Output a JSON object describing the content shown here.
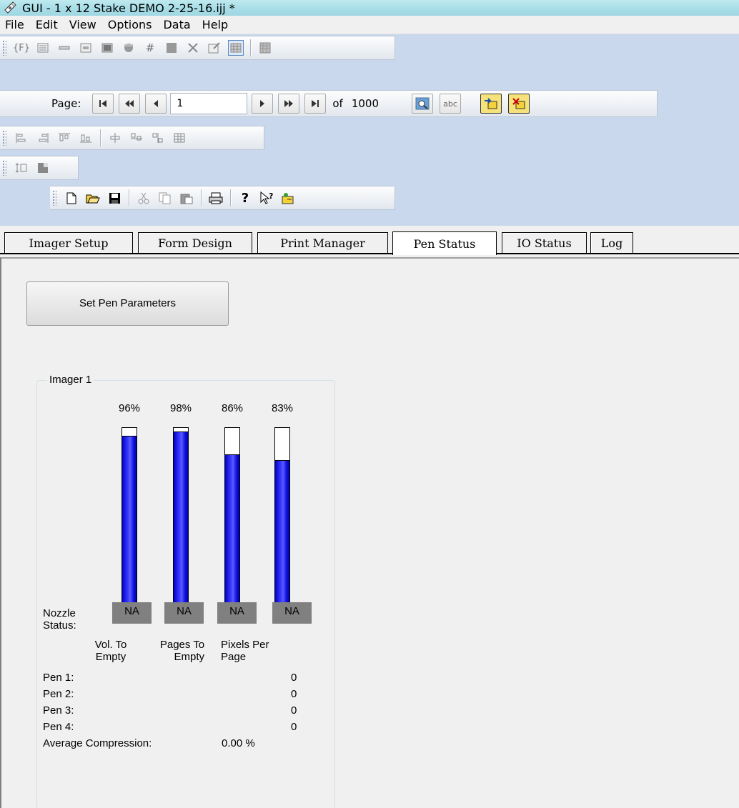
{
  "window": {
    "title": "GUI - 1 x 12 Stake DEMO 2-25-16.ijj *"
  },
  "menu": [
    "File",
    "Edit",
    "View",
    "Options",
    "Data",
    "Help"
  ],
  "page_nav": {
    "label": "Page:",
    "current": "1",
    "of_label": "of",
    "total": "1000",
    "abc_label": "abc"
  },
  "tabs": [
    {
      "label": "Imager Setup",
      "active": false
    },
    {
      "label": "Form Design",
      "active": false
    },
    {
      "label": "Print Manager",
      "active": false
    },
    {
      "label": "Pen Status",
      "active": true
    },
    {
      "label": "IO Status",
      "active": false
    },
    {
      "label": "Log",
      "active": false
    }
  ],
  "pen_status": {
    "set_params_label": "Set Pen Parameters",
    "group_label": "Imager 1",
    "pens": [
      {
        "number": "1",
        "level_label": "96%",
        "level": 0.96,
        "nozzle": "NA"
      },
      {
        "number": "2",
        "level_label": "98%",
        "level": 0.98,
        "nozzle": "NA"
      },
      {
        "number": "3",
        "level_label": "86%",
        "level": 0.86,
        "nozzle": "NA"
      },
      {
        "number": "4",
        "level_label": "83%",
        "level": 0.83,
        "nozzle": "NA"
      }
    ],
    "nozzle_label_1": "Nozzle",
    "nozzle_label_2": "Status:",
    "col_vol_1": "Vol. To",
    "col_vol_2": "Empty",
    "col_pages_1": "Pages To",
    "col_pages_2": "Empty",
    "col_pixels_1": "Pixels Per",
    "col_pixels_2": "Page",
    "rows": [
      {
        "label": "Pen 1:",
        "pixels": "0"
      },
      {
        "label": "Pen 2:",
        "pixels": "0"
      },
      {
        "label": "Pen 3:",
        "pixels": "0"
      },
      {
        "label": "Pen 4:",
        "pixels": "0"
      }
    ],
    "avg_label": "Average Compression:",
    "avg_value": "0.00 %"
  },
  "colors": {
    "title_bar": "#a6dde7",
    "toolbar_bg": "#c9d8ec",
    "pen_fill": "#1a1aff",
    "nozzle_box": "#808080"
  }
}
